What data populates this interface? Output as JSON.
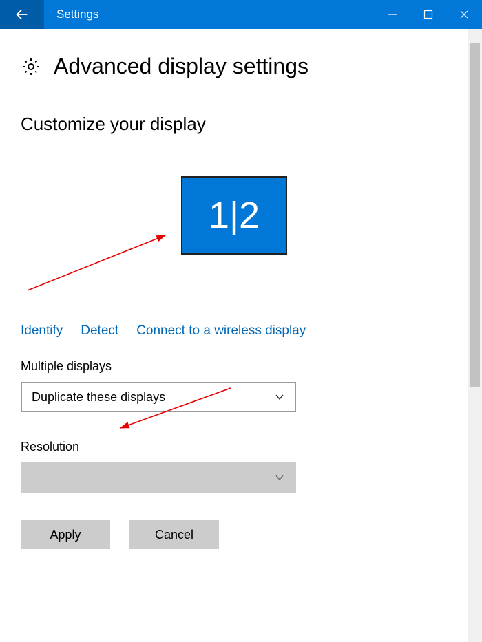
{
  "window": {
    "title": "Settings"
  },
  "header": {
    "title": "Advanced display settings"
  },
  "section": {
    "title": "Customize your display"
  },
  "display": {
    "label": "1|2"
  },
  "links": {
    "identify": "Identify",
    "detect": "Detect",
    "wireless": "Connect to a wireless display"
  },
  "multiple": {
    "label": "Multiple displays",
    "value": "Duplicate these displays"
  },
  "resolution": {
    "label": "Resolution",
    "value": ""
  },
  "buttons": {
    "apply": "Apply",
    "cancel": "Cancel"
  }
}
